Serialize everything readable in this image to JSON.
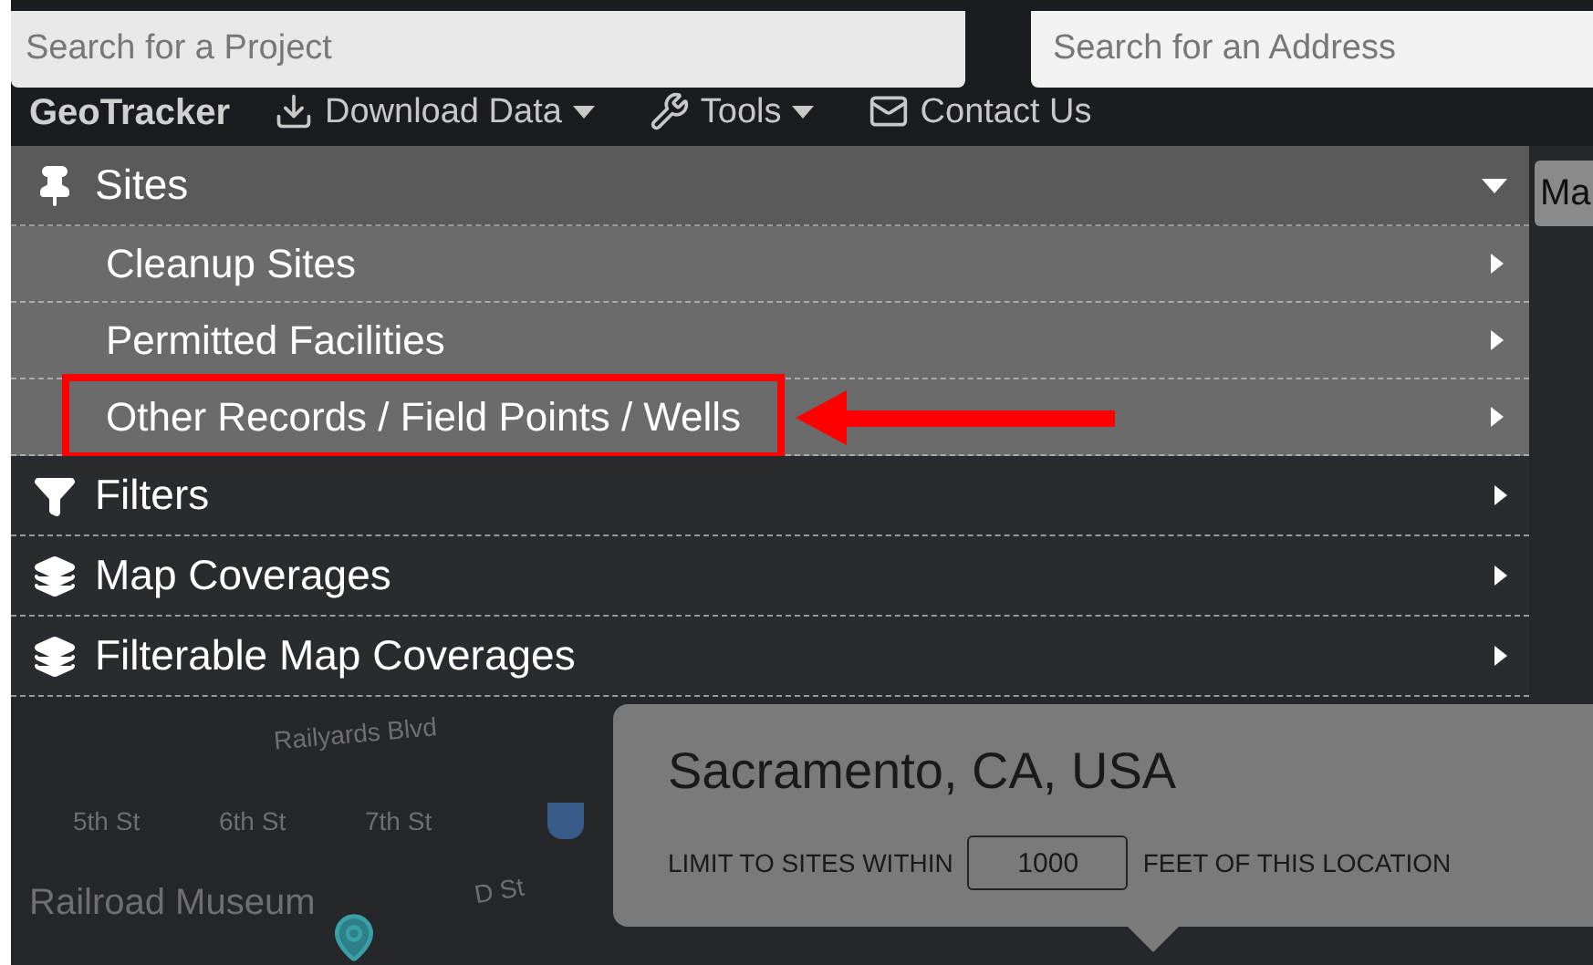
{
  "header": {
    "logo_text": "GeoTracker",
    "project_search": {
      "placeholder": "Search for a Project"
    },
    "address_search": {
      "placeholder": "Search for an Address"
    }
  },
  "nav": [
    {
      "label": "Download Data",
      "kind": "dropdown"
    },
    {
      "label": "Tools",
      "kind": "dropdown"
    },
    {
      "label": "Contact Us",
      "kind": "link"
    }
  ],
  "menu": [
    {
      "label": "Sites",
      "kind": "sites",
      "expanded": true,
      "children": [
        {
          "label": "Cleanup Sites",
          "highlighted": false
        },
        {
          "label": "Permitted Facilities",
          "highlighted": false
        },
        {
          "label": "Other Records / Field Points / Wells",
          "highlighted": true
        }
      ]
    },
    {
      "label": "Filters",
      "kind": "filter",
      "expanded": false
    },
    {
      "label": "Map Coverages",
      "kind": "layers",
      "expanded": false
    },
    {
      "label": "Filterable Map Coverages",
      "kind": "layers",
      "expanded": false
    }
  ],
  "map": {
    "labels": [
      "Railyards Blvd",
      "5th St",
      "6th St",
      "7th St",
      "D St",
      "Railroad Museum"
    ],
    "map_button": "Ma"
  },
  "popup": {
    "address": "Sacramento, CA, USA",
    "limit_label": "LIMIT TO SITES WITHIN",
    "radius": "1000",
    "unit_label": "FEET OF THIS LOCATION"
  }
}
